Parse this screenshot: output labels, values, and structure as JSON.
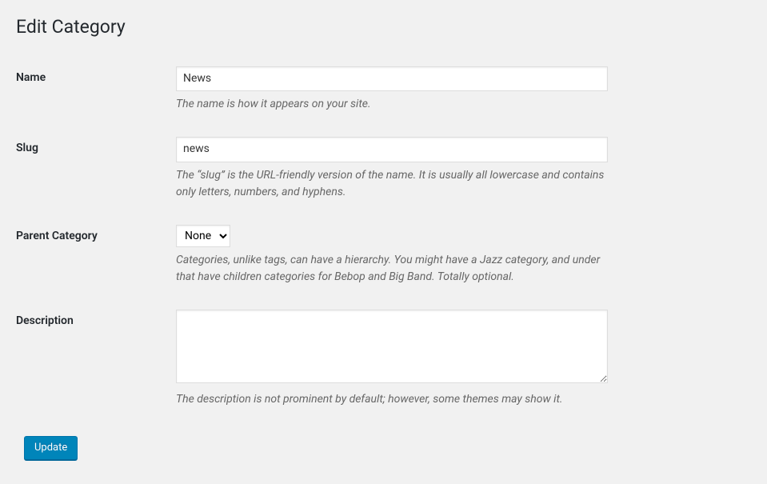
{
  "page": {
    "title": "Edit Category"
  },
  "fields": {
    "name": {
      "label": "Name",
      "value": "News",
      "help": "The name is how it appears on your site."
    },
    "slug": {
      "label": "Slug",
      "value": "news",
      "help": "The “slug” is the URL-friendly version of the name. It is usually all lowercase and contains only letters, numbers, and hyphens."
    },
    "parent": {
      "label": "Parent Category",
      "selected": "None",
      "help": "Categories, unlike tags, can have a hierarchy. You might have a Jazz category, and under that have children categories for Bebop and Big Band. Totally optional."
    },
    "description": {
      "label": "Description",
      "value": "",
      "help": "The description is not prominent by default; however, some themes may show it."
    }
  },
  "actions": {
    "update_label": "Update"
  }
}
